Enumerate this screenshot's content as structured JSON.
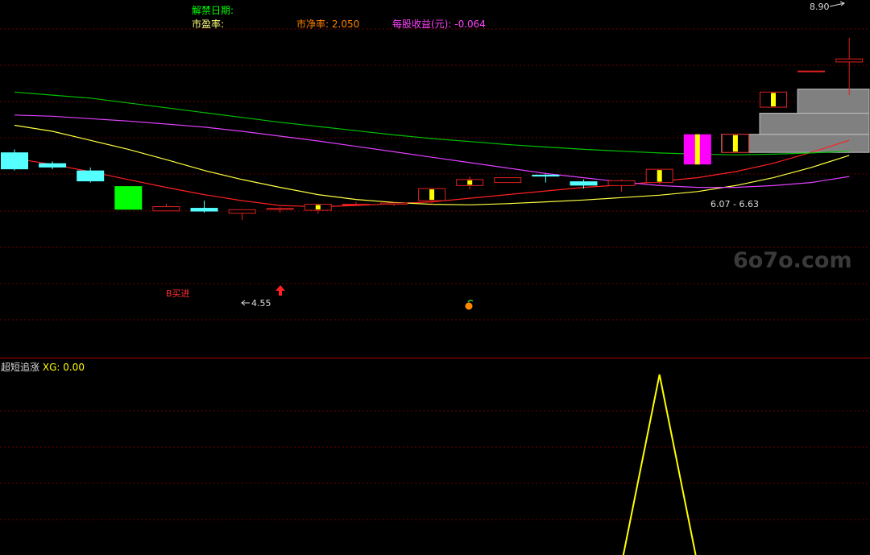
{
  "header": {
    "unlock_label": "解禁日期:",
    "pe_label": "市盈率:",
    "pe_value": "",
    "pb_label": "市净率:",
    "pb_value": "2.050",
    "eps_label": "每股收益(元):",
    "eps_value": "-0.064"
  },
  "colors": {
    "background": "#000000",
    "grid": "#6b0000",
    "divider": "#b00000",
    "candle_up": "#e02020",
    "candle_down": "#55ffff",
    "candle_big_down": "#00ff00",
    "limit_up": "#ff00ff",
    "highlight": "#ffff00",
    "gray_block": "#808080",
    "ma_red": "#ff2020",
    "ma_yellow": "#ffff40",
    "ma_magenta": "#e040ff",
    "ma_green": "#00c000",
    "indicator_line": "#ffff00",
    "header_green": "#00ff00",
    "header_yellow": "#ffff80",
    "header_orange": "#ff8000",
    "header_magenta": "#ff40ff",
    "label_red": "#ff3030",
    "label_white": "#dddddd"
  },
  "annotations": {
    "high_value": "8.90",
    "low_value": "4.55",
    "buy_signal": "B买进",
    "price_range": "6.07 - 6.63",
    "watermark": "6o7o.com"
  },
  "indicator": {
    "name": "超短追涨",
    "series_label": "XG:",
    "series_value": "0.00"
  },
  "chart_data": {
    "type": "candlestick",
    "title": "",
    "price_range": [
      4.05,
      9.1
    ],
    "candles": [
      {
        "o": 7.0,
        "h": 7.05,
        "l": 6.7,
        "c": 6.72
      },
      {
        "o": 6.82,
        "h": 6.85,
        "l": 6.72,
        "c": 6.75
      },
      {
        "o": 6.7,
        "h": 6.75,
        "l": 6.5,
        "c": 6.52
      },
      {
        "o": 6.44,
        "h": 6.44,
        "l": 6.05,
        "c": 6.05
      },
      {
        "o": 6.03,
        "h": 6.15,
        "l": 6.02,
        "c": 6.1
      },
      {
        "o": 6.08,
        "h": 6.2,
        "l": 6.0,
        "c": 6.02
      },
      {
        "o": 5.99,
        "h": 6.05,
        "l": 5.88,
        "c": 6.05
      },
      {
        "o": 6.07,
        "h": 6.09,
        "l": 6.0,
        "c": 6.07
      },
      {
        "o": 6.04,
        "h": 6.15,
        "l": 5.98,
        "c": 6.14
      },
      {
        "o": 6.14,
        "h": 6.18,
        "l": 6.12,
        "c": 6.14
      },
      {
        "o": 6.14,
        "h": 6.16,
        "l": 6.11,
        "c": 6.16
      },
      {
        "o": 6.2,
        "h": 6.4,
        "l": 6.14,
        "c": 6.4
      },
      {
        "o": 6.45,
        "h": 6.6,
        "l": 6.38,
        "c": 6.55
      },
      {
        "o": 6.5,
        "h": 6.58,
        "l": 6.5,
        "c": 6.58
      },
      {
        "o": 6.63,
        "h": 6.64,
        "l": 6.5,
        "c": 6.6
      },
      {
        "o": 6.52,
        "h": 6.55,
        "l": 6.4,
        "c": 6.45
      },
      {
        "o": 6.45,
        "h": 6.55,
        "l": 6.35,
        "c": 6.53
      },
      {
        "o": 6.5,
        "h": 6.72,
        "l": 6.47,
        "c": 6.72
      },
      {
        "o": 6.8,
        "h": 7.3,
        "l": 6.8,
        "c": 7.3
      },
      {
        "o": 7.0,
        "h": 7.3,
        "l": 7.0,
        "c": 7.3
      },
      {
        "o": 7.75,
        "h": 8.0,
        "l": 7.75,
        "c": 8.0
      },
      {
        "o": 8.35,
        "h": 8.35,
        "l": 8.35,
        "c": 8.35
      },
      {
        "o": 8.5,
        "h": 8.9,
        "l": 7.95,
        "c": 8.55
      }
    ],
    "ma_series": [
      {
        "values": [
          6.9,
          6.8,
          6.68,
          6.55,
          6.42,
          6.3,
          6.2,
          6.12,
          6.1,
          6.12,
          6.15,
          6.18,
          6.24,
          6.3,
          6.36,
          6.42,
          6.46,
          6.52,
          6.58,
          6.68,
          6.82,
          7.0,
          7.2
        ]
      },
      {
        "values": [
          7.45,
          7.35,
          7.2,
          7.05,
          6.88,
          6.7,
          6.55,
          6.42,
          6.3,
          6.22,
          6.17,
          6.14,
          6.13,
          6.15,
          6.18,
          6.21,
          6.25,
          6.29,
          6.35,
          6.45,
          6.58,
          6.75,
          6.95
        ]
      },
      {
        "values": [
          7.62,
          7.6,
          7.56,
          7.52,
          7.47,
          7.42,
          7.35,
          7.27,
          7.19,
          7.1,
          7.01,
          6.92,
          6.83,
          6.74,
          6.65,
          6.58,
          6.51,
          6.45,
          6.42,
          6.42,
          6.45,
          6.5,
          6.6
        ]
      },
      {
        "values": [
          8.0,
          7.95,
          7.9,
          7.82,
          7.74,
          7.66,
          7.58,
          7.5,
          7.43,
          7.36,
          7.29,
          7.23,
          7.18,
          7.13,
          7.09,
          7.05,
          7.02,
          6.99,
          6.97,
          6.96,
          6.97,
          6.99,
          7.02
        ]
      }
    ],
    "gray_blocks": [
      {
        "from_index": 19,
        "low": 7.0,
        "high": 7.3
      },
      {
        "from_index": 20,
        "low": 7.3,
        "high": 7.65
      },
      {
        "from_index": 21,
        "low": 7.65,
        "high": 8.05
      }
    ],
    "indicator_series": {
      "name": "XG",
      "values": [
        0,
        0,
        0,
        0,
        0,
        0,
        0,
        0,
        0,
        0,
        0,
        0,
        0,
        0,
        0,
        0,
        0,
        1,
        0,
        0,
        0,
        0,
        0
      ]
    }
  }
}
